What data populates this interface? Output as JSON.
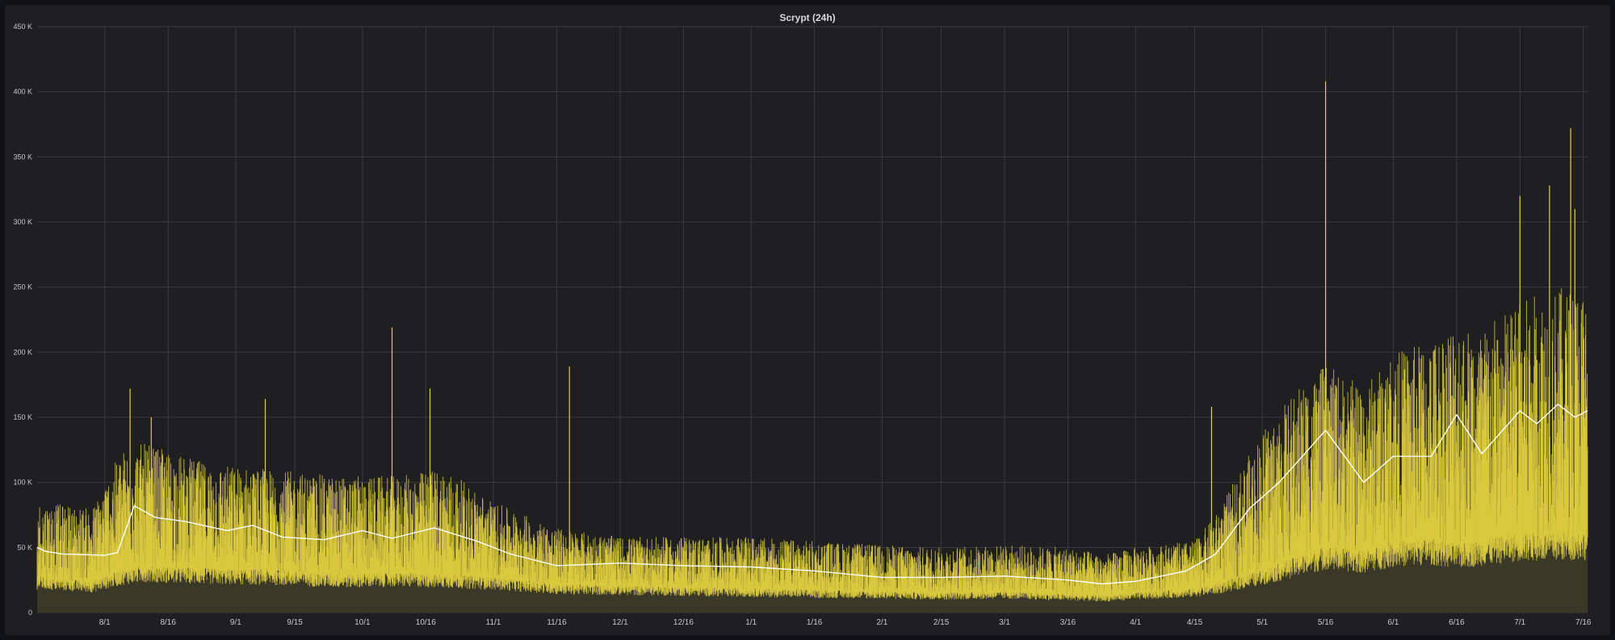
{
  "panel": {
    "title": "Scrypt (24h)"
  },
  "colors": {
    "background": "#1f1f22",
    "grid": "#3a3b40",
    "bars": "#e0cf3f",
    "fill": "#3a3826",
    "ma": "#ffffff",
    "text": "#c7c8ca"
  },
  "chart_data": {
    "type": "bar",
    "title": "Scrypt (24h)",
    "xlabel": "",
    "ylabel": "",
    "ylim": [
      0,
      450000
    ],
    "yticks": [
      0,
      50000,
      100000,
      150000,
      200000,
      250000,
      300000,
      350000,
      400000,
      450000
    ],
    "ytick_labels": [
      "0",
      "50 K",
      "100 K",
      "150 K",
      "200 K",
      "250 K",
      "300 K",
      "350 K",
      "400 K",
      "450 K"
    ],
    "grid": true,
    "legend": "none",
    "x_start": "2023-07-16",
    "x_end": "2024-07-17",
    "xticks": [
      "2023-08-01",
      "2023-08-16",
      "2023-09-01",
      "2023-09-15",
      "2023-10-01",
      "2023-10-16",
      "2023-11-01",
      "2023-11-16",
      "2023-12-01",
      "2023-12-16",
      "2024-01-01",
      "2024-01-16",
      "2024-02-01",
      "2024-02-15",
      "2024-03-01",
      "2024-03-16",
      "2024-04-01",
      "2024-04-15",
      "2024-05-01",
      "2024-05-16",
      "2024-06-01",
      "2024-06-16",
      "2024-07-01",
      "2024-07-16"
    ],
    "xtick_labels": [
      "8/1",
      "8/16",
      "9/1",
      "9/15",
      "10/1",
      "10/16",
      "11/1",
      "11/16",
      "12/1",
      "12/16",
      "1/1",
      "1/16",
      "2/1",
      "2/15",
      "3/1",
      "3/16",
      "4/1",
      "4/15",
      "5/1",
      "5/16",
      "6/1",
      "6/16",
      "7/1",
      "7/16"
    ],
    "series": [
      {
        "style": "bars",
        "color": "#e0cf3f",
        "envelope": {
          "x": [
            "2023-07-16",
            "2023-07-25",
            "2023-07-29",
            "2023-08-05",
            "2023-08-10",
            "2023-08-25",
            "2023-09-10",
            "2023-09-25",
            "2023-10-10",
            "2023-10-20",
            "2023-11-01",
            "2023-11-16",
            "2023-12-01",
            "2023-12-16",
            "2024-01-01",
            "2024-01-16",
            "2024-02-01",
            "2024-02-15",
            "2024-03-01",
            "2024-03-16",
            "2024-03-25",
            "2024-04-01",
            "2024-04-15",
            "2024-04-20",
            "2024-05-01",
            "2024-05-10",
            "2024-05-16",
            "2024-05-25",
            "2024-06-01",
            "2024-06-10",
            "2024-06-16",
            "2024-06-20",
            "2024-07-01",
            "2024-07-10",
            "2024-07-17"
          ],
          "low": [
            25000,
            23000,
            22000,
            30000,
            33000,
            31000,
            30000,
            27000,
            28000,
            27000,
            25000,
            20000,
            19000,
            18000,
            17000,
            16000,
            15000,
            14000,
            15000,
            13000,
            12000,
            14000,
            17000,
            20000,
            30000,
            40000,
            47000,
            43000,
            50000,
            52000,
            48000,
            50000,
            56000,
            56000,
            58000
          ],
          "high": [
            85000,
            82000,
            80000,
            125000,
            130000,
            115000,
            110000,
            105000,
            105000,
            112000,
            85000,
            65000,
            58000,
            58000,
            58000,
            55000,
            52000,
            50000,
            52000,
            50000,
            45000,
            50000,
            55000,
            75000,
            140000,
            175000,
            190000,
            175000,
            200000,
            210000,
            230000,
            215000,
            240000,
            250000,
            250000
          ]
        },
        "spikes": [
          {
            "x": "2023-08-07",
            "value": 172000
          },
          {
            "x": "2023-08-12",
            "value": 150000
          },
          {
            "x": "2023-09-08",
            "value": 164000
          },
          {
            "x": "2023-10-08",
            "value": 219000
          },
          {
            "x": "2023-10-17",
            "value": 172000
          },
          {
            "x": "2023-11-19",
            "value": 189000
          },
          {
            "x": "2024-04-19",
            "value": 158000
          },
          {
            "x": "2024-05-16",
            "value": 408000
          },
          {
            "x": "2024-07-01",
            "value": 320000
          },
          {
            "x": "2024-07-08",
            "value": 328000
          },
          {
            "x": "2024-07-13",
            "value": 372000
          },
          {
            "x": "2024-07-14",
            "value": 310000
          }
        ]
      },
      {
        "style": "line",
        "color": "#ffffff",
        "x": [
          "2023-07-16",
          "2023-07-18",
          "2023-07-22",
          "2023-08-01",
          "2023-08-04",
          "2023-08-08",
          "2023-08-13",
          "2023-08-20",
          "2023-08-30",
          "2023-09-05",
          "2023-09-12",
          "2023-09-22",
          "2023-10-01",
          "2023-10-08",
          "2023-10-18",
          "2023-10-28",
          "2023-11-05",
          "2023-11-16",
          "2023-12-01",
          "2023-12-16",
          "2024-01-01",
          "2024-01-16",
          "2024-02-01",
          "2024-02-15",
          "2024-03-01",
          "2024-03-16",
          "2024-03-24",
          "2024-04-01",
          "2024-04-13",
          "2024-04-20",
          "2024-04-28",
          "2024-05-05",
          "2024-05-16",
          "2024-05-25",
          "2024-06-01",
          "2024-06-10",
          "2024-06-16",
          "2024-06-22",
          "2024-07-01",
          "2024-07-05",
          "2024-07-10",
          "2024-07-14",
          "2024-07-17"
        ],
        "values": [
          50000,
          47000,
          45000,
          44000,
          46000,
          82000,
          73000,
          70000,
          63000,
          67000,
          58000,
          56000,
          63000,
          57000,
          65000,
          55000,
          45000,
          36000,
          38000,
          36000,
          35000,
          32000,
          27000,
          27000,
          28000,
          25000,
          22000,
          24000,
          32000,
          45000,
          80000,
          100000,
          140000,
          100000,
          120000,
          120000,
          152000,
          122000,
          155000,
          145000,
          160000,
          150000,
          155000
        ]
      }
    ]
  }
}
